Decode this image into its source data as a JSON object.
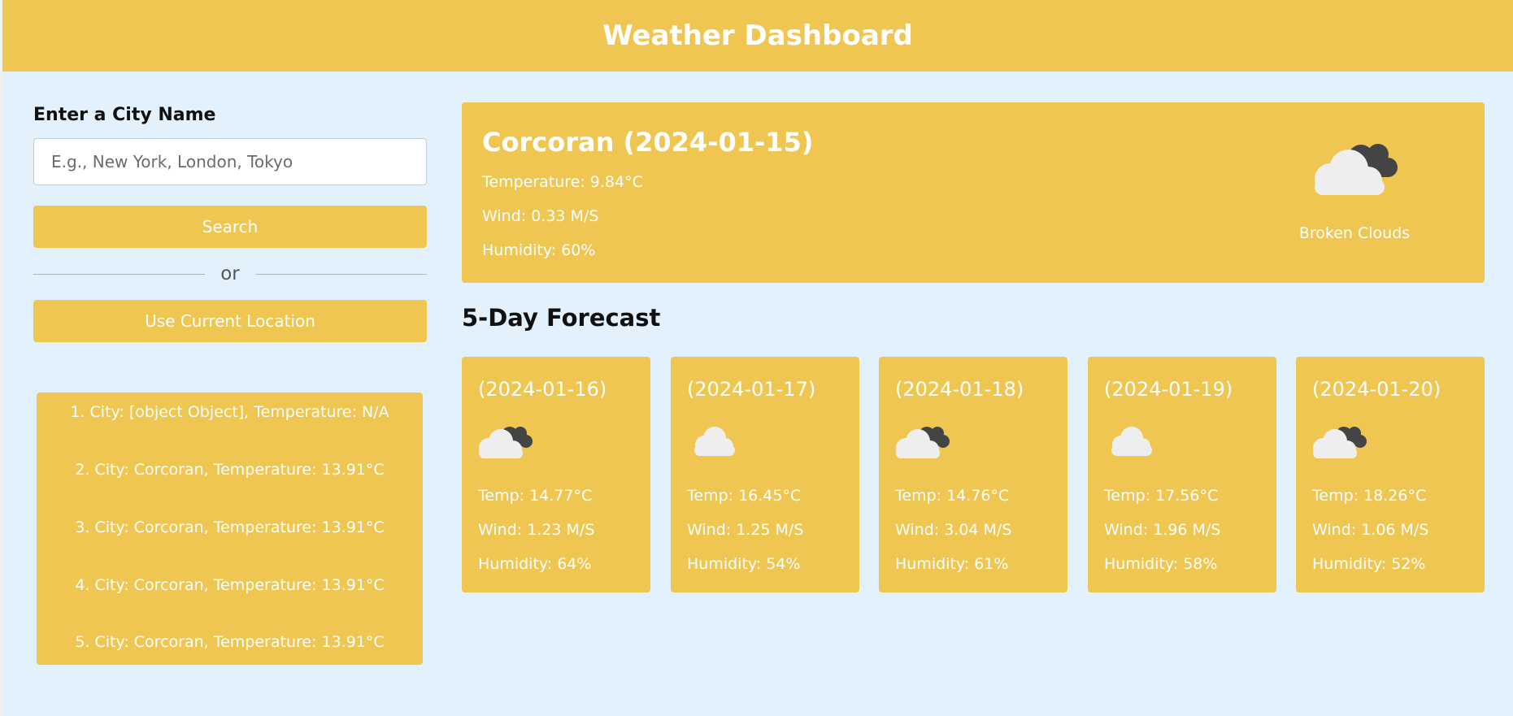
{
  "header": {
    "title": "Weather Dashboard"
  },
  "sidebar": {
    "label": "Enter a City Name",
    "input_placeholder": "E.g., New York, London, Tokyo",
    "search_label": "Search",
    "or_label": "or",
    "location_label": "Use Current Location"
  },
  "history": [
    "1. City: [object Object], Temperature: N/A",
    "2. City: Corcoran, Temperature: 13.91°C",
    "3. City: Corcoran, Temperature: 13.91°C",
    "4. City: Corcoran, Temperature: 13.91°C",
    "5. City: Corcoran, Temperature: 13.91°C"
  ],
  "current": {
    "title": "Corcoran (2024-01-15)",
    "temperature": "Temperature: 9.84°C",
    "wind": "Wind: 0.33 M/S",
    "humidity": "Humidity: 60%",
    "condition": "Broken Clouds",
    "icon": "broken-clouds-icon"
  },
  "forecast": {
    "title": "5-Day Forecast",
    "days": [
      {
        "date": "(2024-01-16)",
        "icon": "broken-clouds-icon",
        "temp": "Temp: 14.77°C",
        "wind": "Wind: 1.23 M/S",
        "humidity": "Humidity: 64%"
      },
      {
        "date": "(2024-01-17)",
        "icon": "cloud-icon",
        "temp": "Temp: 16.45°C",
        "wind": "Wind: 1.25 M/S",
        "humidity": "Humidity: 54%"
      },
      {
        "date": "(2024-01-18)",
        "icon": "broken-clouds-icon",
        "temp": "Temp: 14.76°C",
        "wind": "Wind: 3.04 M/S",
        "humidity": "Humidity: 61%"
      },
      {
        "date": "(2024-01-19)",
        "icon": "cloud-icon",
        "temp": "Temp: 17.56°C",
        "wind": "Wind: 1.96 M/S",
        "humidity": "Humidity: 58%"
      },
      {
        "date": "(2024-01-20)",
        "icon": "broken-clouds-icon",
        "temp": "Temp: 18.26°C",
        "wind": "Wind: 1.06 M/S",
        "humidity": "Humidity: 52%"
      }
    ]
  },
  "colors": {
    "accent": "#efc651",
    "background": "#e2f1fb",
    "text_on_accent": "#ffffff"
  }
}
